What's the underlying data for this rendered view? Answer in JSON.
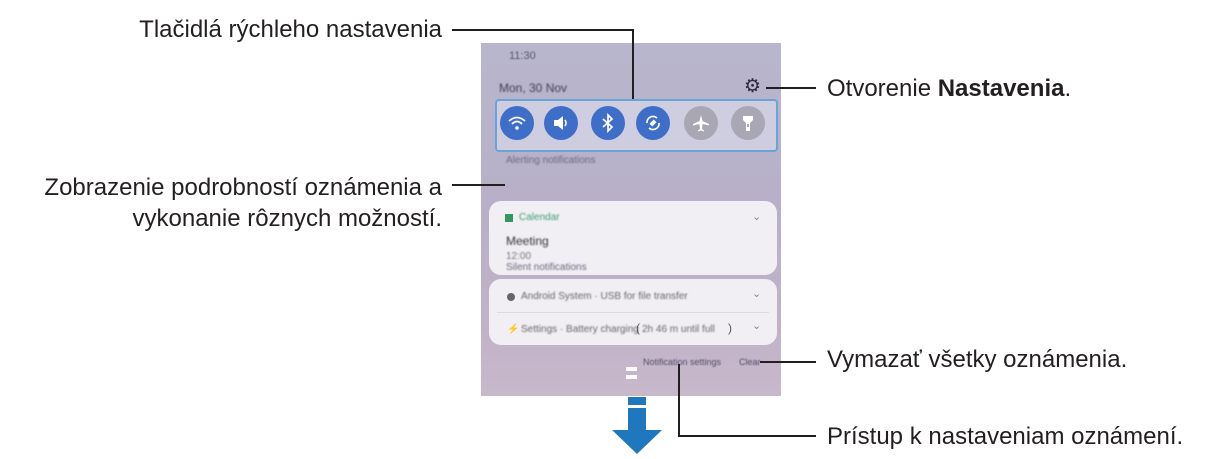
{
  "callouts": {
    "quick_settings": "Tlačidlá rýchleho nastavenia",
    "open_settings_prefix": "Otvorenie ",
    "open_settings_bold": "Nastavenia",
    "open_settings_suffix": ".",
    "notification_details_line1": "Zobrazenie podrobností oznámenia a",
    "notification_details_line2": "vykonanie rôznych možností.",
    "clear_all": "Vymazať všetky oznámenia.",
    "notification_settings_access": "Prístup k nastaveniam oznámení."
  },
  "phone": {
    "status_time": "11:30",
    "date": "Mon, 30 Nov",
    "quick_buttons": [
      {
        "name": "wifi-icon",
        "state": "on"
      },
      {
        "name": "sound-icon",
        "state": "on"
      },
      {
        "name": "bluetooth-icon",
        "state": "on"
      },
      {
        "name": "auto-rotate-icon",
        "state": "on"
      },
      {
        "name": "airplane-icon",
        "state": "off"
      },
      {
        "name": "flashlight-icon",
        "state": "off"
      }
    ],
    "alerting_label": "Alerting notifications",
    "calendar_app": "Calendar",
    "event_title": "Meeting",
    "event_time": "12:00",
    "silent_label": "Silent notifications",
    "silent_item1": "Android System · USB for file transfer",
    "silent_item2_prefix": "Settings · Battery charging",
    "silent_item2_paren_open": "(",
    "silent_item2_detail": "2h 46 m until full",
    "silent_item2_paren_close": ")",
    "notification_settings": "Notification settings",
    "clear": "Clear"
  },
  "colors": {
    "accent_blue": "#3f6ec9",
    "highlight_frame": "#6aa3d6",
    "arrow_blue": "#1f78bd"
  }
}
